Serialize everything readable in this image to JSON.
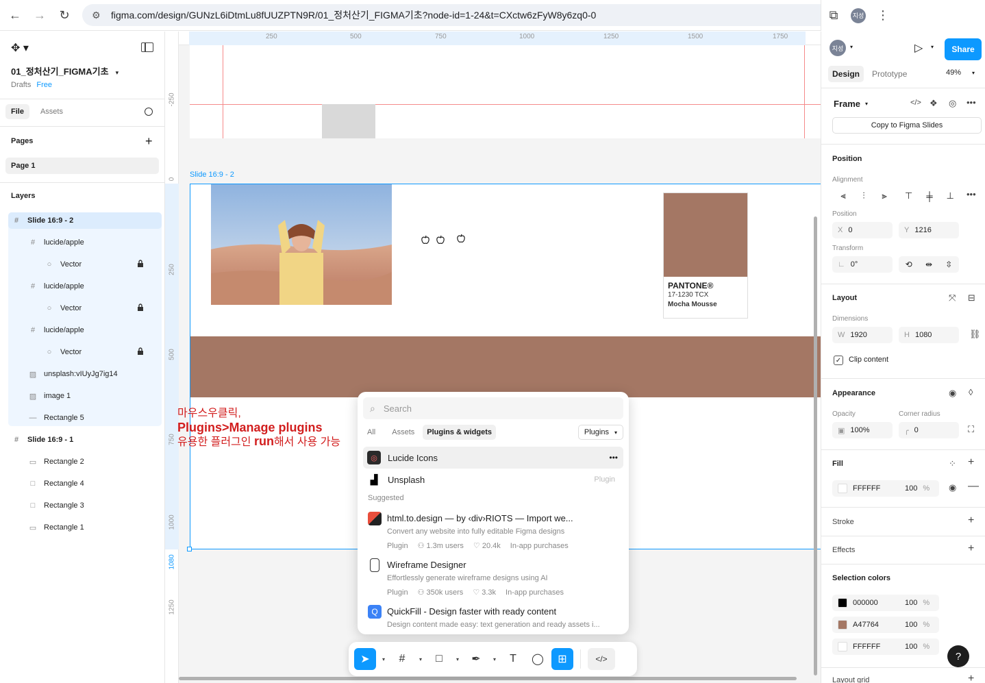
{
  "browser": {
    "url": "figma.com/design/GUNzL6iDtmLu8fUUZPTN9R/01_정처산기_FIGMA기초?node-id=1-24&t=CXctw6zFyW8y6zq0-0",
    "profile_initials": "지성"
  },
  "left_panel": {
    "file_title": "01_정처산기_FIGMA기초",
    "drafts": "Drafts",
    "plan": "Free",
    "tabs": [
      "File",
      "Assets"
    ],
    "pages_title": "Pages",
    "page": "Page 1",
    "layers_title": "Layers",
    "layers": [
      {
        "label": "Slide 16:9 - 2",
        "icon": "#",
        "indent": 0,
        "lock": false
      },
      {
        "label": "lucide/apple",
        "icon": "#",
        "indent": 1,
        "lock": false
      },
      {
        "label": "Vector",
        "icon": "○",
        "indent": 2,
        "lock": true
      },
      {
        "label": "lucide/apple",
        "icon": "#",
        "indent": 1,
        "lock": false
      },
      {
        "label": "Vector",
        "icon": "○",
        "indent": 2,
        "lock": true
      },
      {
        "label": "lucide/apple",
        "icon": "#",
        "indent": 1,
        "lock": false
      },
      {
        "label": "Vector",
        "icon": "○",
        "indent": 2,
        "lock": true
      },
      {
        "label": "unsplash:vIUyJg7ig14",
        "icon": "▨",
        "indent": 1,
        "lock": false
      },
      {
        "label": "image 1",
        "icon": "▨",
        "indent": 1,
        "lock": false
      },
      {
        "label": "Rectangle 5",
        "icon": "—",
        "indent": 1,
        "lock": false
      },
      {
        "label": "Slide 16:9 - 1",
        "icon": "#",
        "indent": 0,
        "lock": false
      },
      {
        "label": "Rectangle 2",
        "icon": "▭",
        "indent": 1,
        "lock": false
      },
      {
        "label": "Rectangle 4",
        "icon": "□",
        "indent": 1,
        "lock": false
      },
      {
        "label": "Rectangle 3",
        "icon": "□",
        "indent": 1,
        "lock": false
      },
      {
        "label": "Rectangle 1",
        "icon": "▭",
        "indent": 1,
        "lock": false
      }
    ]
  },
  "canvas": {
    "ruler_top": [
      "250",
      "500",
      "750",
      "1000",
      "1250",
      "1500",
      "1750"
    ],
    "ruler_left": [
      "-250",
      "0",
      "250",
      "500",
      "750",
      "1000",
      "1080",
      "1250"
    ],
    "slide_label": "Slide 16:9 - 2",
    "pantone": {
      "brand": "PANTONE®",
      "code": "17-1230 TCX",
      "name": "Mocha Mousse",
      "color": "#A47764"
    },
    "note_line1": "마우스우클릭,",
    "note_line2": "Plugins>Manage plugins",
    "note_line3_pre": "유용한 플러그인 ",
    "note_line3_bold": "run",
    "note_line3_post": "해서 사용 가능"
  },
  "plugins_popup": {
    "search_placeholder": "Search",
    "tabs": [
      "All",
      "Assets",
      "Plugins & widgets"
    ],
    "filter": "Plugins",
    "recent": [
      {
        "name": "Lucide Icons",
        "more": "•••"
      },
      {
        "name": "Unsplash",
        "tag": "Plugin"
      }
    ],
    "suggested_title": "Suggested",
    "suggested": [
      {
        "title": "html.to.design — by ‹div›RIOTS — Import we...",
        "desc": "Convert any website into fully editable Figma designs",
        "type": "Plugin",
        "users": "1.3m users",
        "likes": "20.4k",
        "purchase": "In-app purchases"
      },
      {
        "title": "Wireframe Designer",
        "desc": "Effortlessly generate wireframe designs using AI",
        "type": "Plugin",
        "users": "350k users",
        "likes": "3.3k",
        "purchase": "In-app purchases"
      },
      {
        "title": "QuickFill - Design faster with ready content",
        "desc": "Design content made easy: text generation and ready assets i...",
        "type": "",
        "users": "",
        "likes": "",
        "purchase": ""
      }
    ]
  },
  "right_panel": {
    "avatar": "지성",
    "share": "Share",
    "tabs": [
      "Design",
      "Prototype"
    ],
    "zoom": "49%",
    "frame": "Frame",
    "copy_slides": "Copy to Figma Slides",
    "position_title": "Position",
    "alignment_label": "Alignment",
    "position_label": "Position",
    "x": "0",
    "y": "1216",
    "transform_label": "Transform",
    "rotation": "0°",
    "layout_title": "Layout",
    "dimensions_label": "Dimensions",
    "w": "1920",
    "h": "1080",
    "clip": "Clip content",
    "appearance_title": "Appearance",
    "opacity_label": "Opacity",
    "opacity": "100%",
    "radius_label": "Corner radius",
    "radius": "0",
    "fill_title": "Fill",
    "fill_hex": "FFFFFF",
    "fill_pct": "100",
    "stroke_title": "Stroke",
    "effects_title": "Effects",
    "selection_title": "Selection colors",
    "selection_colors": [
      {
        "hex": "000000",
        "pct": "100",
        "color": "#000000"
      },
      {
        "hex": "A47764",
        "pct": "100",
        "color": "#A47764"
      },
      {
        "hex": "FFFFFF",
        "pct": "100",
        "color": "#FFFFFF"
      }
    ],
    "layout_grid": "Layout grid",
    "help": "?"
  }
}
